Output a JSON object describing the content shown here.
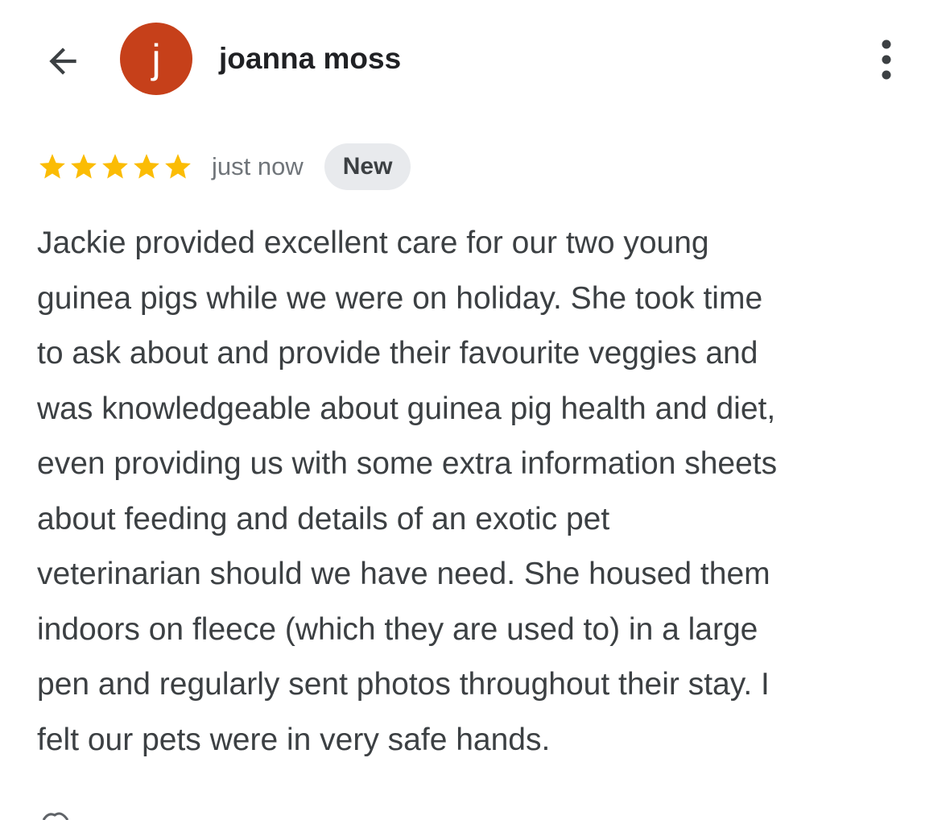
{
  "header": {
    "back_icon": "arrow-left-icon",
    "avatar_letter": "j",
    "avatar_color": "#c6401a",
    "username": "joanna moss",
    "more_icon": "more-vert-icon"
  },
  "review": {
    "rating": 5,
    "rating_max": 5,
    "star_color": "#fbbc04",
    "time": "just now",
    "badge": "New",
    "lines": [
      "Jackie provided excellent care for our two young",
      "guinea pigs while we were on holiday. She took time",
      "to ask about and provide their favourite veggies and",
      "was knowledgeable about guinea pig health and diet,",
      "even providing us with some extra information sheets",
      "about feeding and details of an exotic pet",
      "veterinarian should we have need. She housed them",
      "indoors on fleece (which they are used to) in a large",
      "pen and regularly sent photos throughout their stay. I",
      "felt our pets were in very safe hands."
    ]
  }
}
